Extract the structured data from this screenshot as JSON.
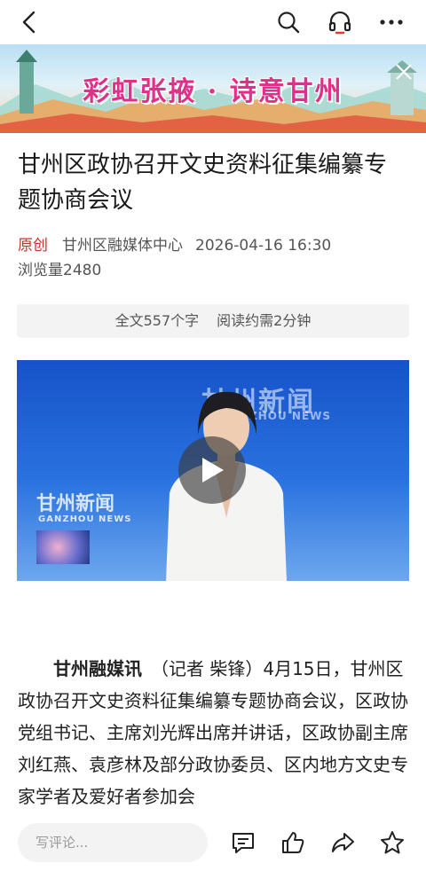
{
  "header": {
    "back_icon": "chevron-left-icon",
    "search_icon": "search-icon",
    "listen_icon": "headphones-icon",
    "more_icon": "more-dots-icon"
  },
  "banner": {
    "title": "彩虹张掖 · 诗意甘州"
  },
  "article": {
    "title": "甘州区政协召开文史资料征集编纂专题协商会议",
    "original_tag": "原创",
    "source": "甘州区融媒体中心",
    "date": "2026-04-16",
    "time": "16:30",
    "views": "浏览量2480",
    "word_count": "全文557个字",
    "read_time": "阅读约需2分钟",
    "video": {
      "logo_cn": "甘州新闻",
      "logo_en": "ZHOU NEWS",
      "logo_small_cn": "甘州新闻",
      "logo_small_en": "GANZHOU NEWS"
    },
    "lead": "甘州融媒讯",
    "body": "（记者 柴锋）4月15日，甘州区政协召开文史资料征集编纂专题协商会议，区政协党组书记、主席刘光辉出席并讲话，区政协副主席刘红燕、袁彦林及部分政协委员、区内地方文史专家学者及爱好者参加会"
  },
  "bottombar": {
    "comment_placeholder": "写评论...",
    "icons": [
      "comment-icon",
      "like-icon",
      "share-icon",
      "favorite-star-icon"
    ]
  },
  "colors": {
    "accent_red": "#c8302b",
    "banner_title": "#e0308a",
    "video_blue": "#1f63d6"
  }
}
